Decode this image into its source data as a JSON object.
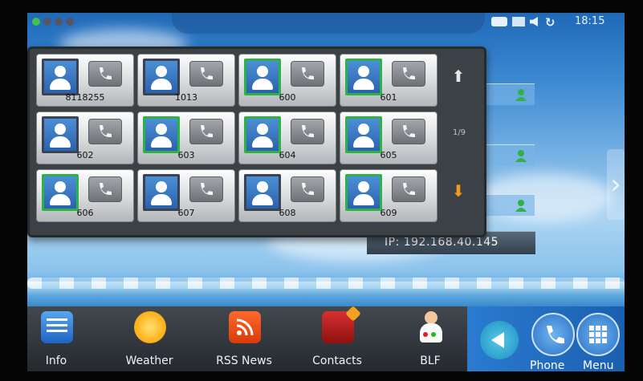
{
  "status_bar": {
    "time": "18:15"
  },
  "blf_panel": {
    "page_indicator": "1/9",
    "items": [
      {
        "ext": "8118255",
        "active": false
      },
      {
        "ext": "1013",
        "active": false
      },
      {
        "ext": "600",
        "active": true
      },
      {
        "ext": "601",
        "active": true
      },
      {
        "ext": "602",
        "active": false
      },
      {
        "ext": "603",
        "active": true
      },
      {
        "ext": "604",
        "active": true
      },
      {
        "ext": "605",
        "active": true
      },
      {
        "ext": "606",
        "active": true
      },
      {
        "ext": "607",
        "active": false
      },
      {
        "ext": "608",
        "active": false
      },
      {
        "ext": "609",
        "active": true
      }
    ]
  },
  "ip_label": "IP: 192.168.40.145",
  "dock": {
    "info": "Info",
    "weather": "Weather",
    "rss": "RSS News",
    "contacts": "Contacts",
    "blf": "BLF",
    "phone": "Phone",
    "menu": "Menu"
  },
  "colors": {
    "active_border": "#2fb245",
    "up_arrow": "#e7e7e7",
    "down_arrow": "#f39a1e",
    "presence_green": "#2fb245"
  }
}
